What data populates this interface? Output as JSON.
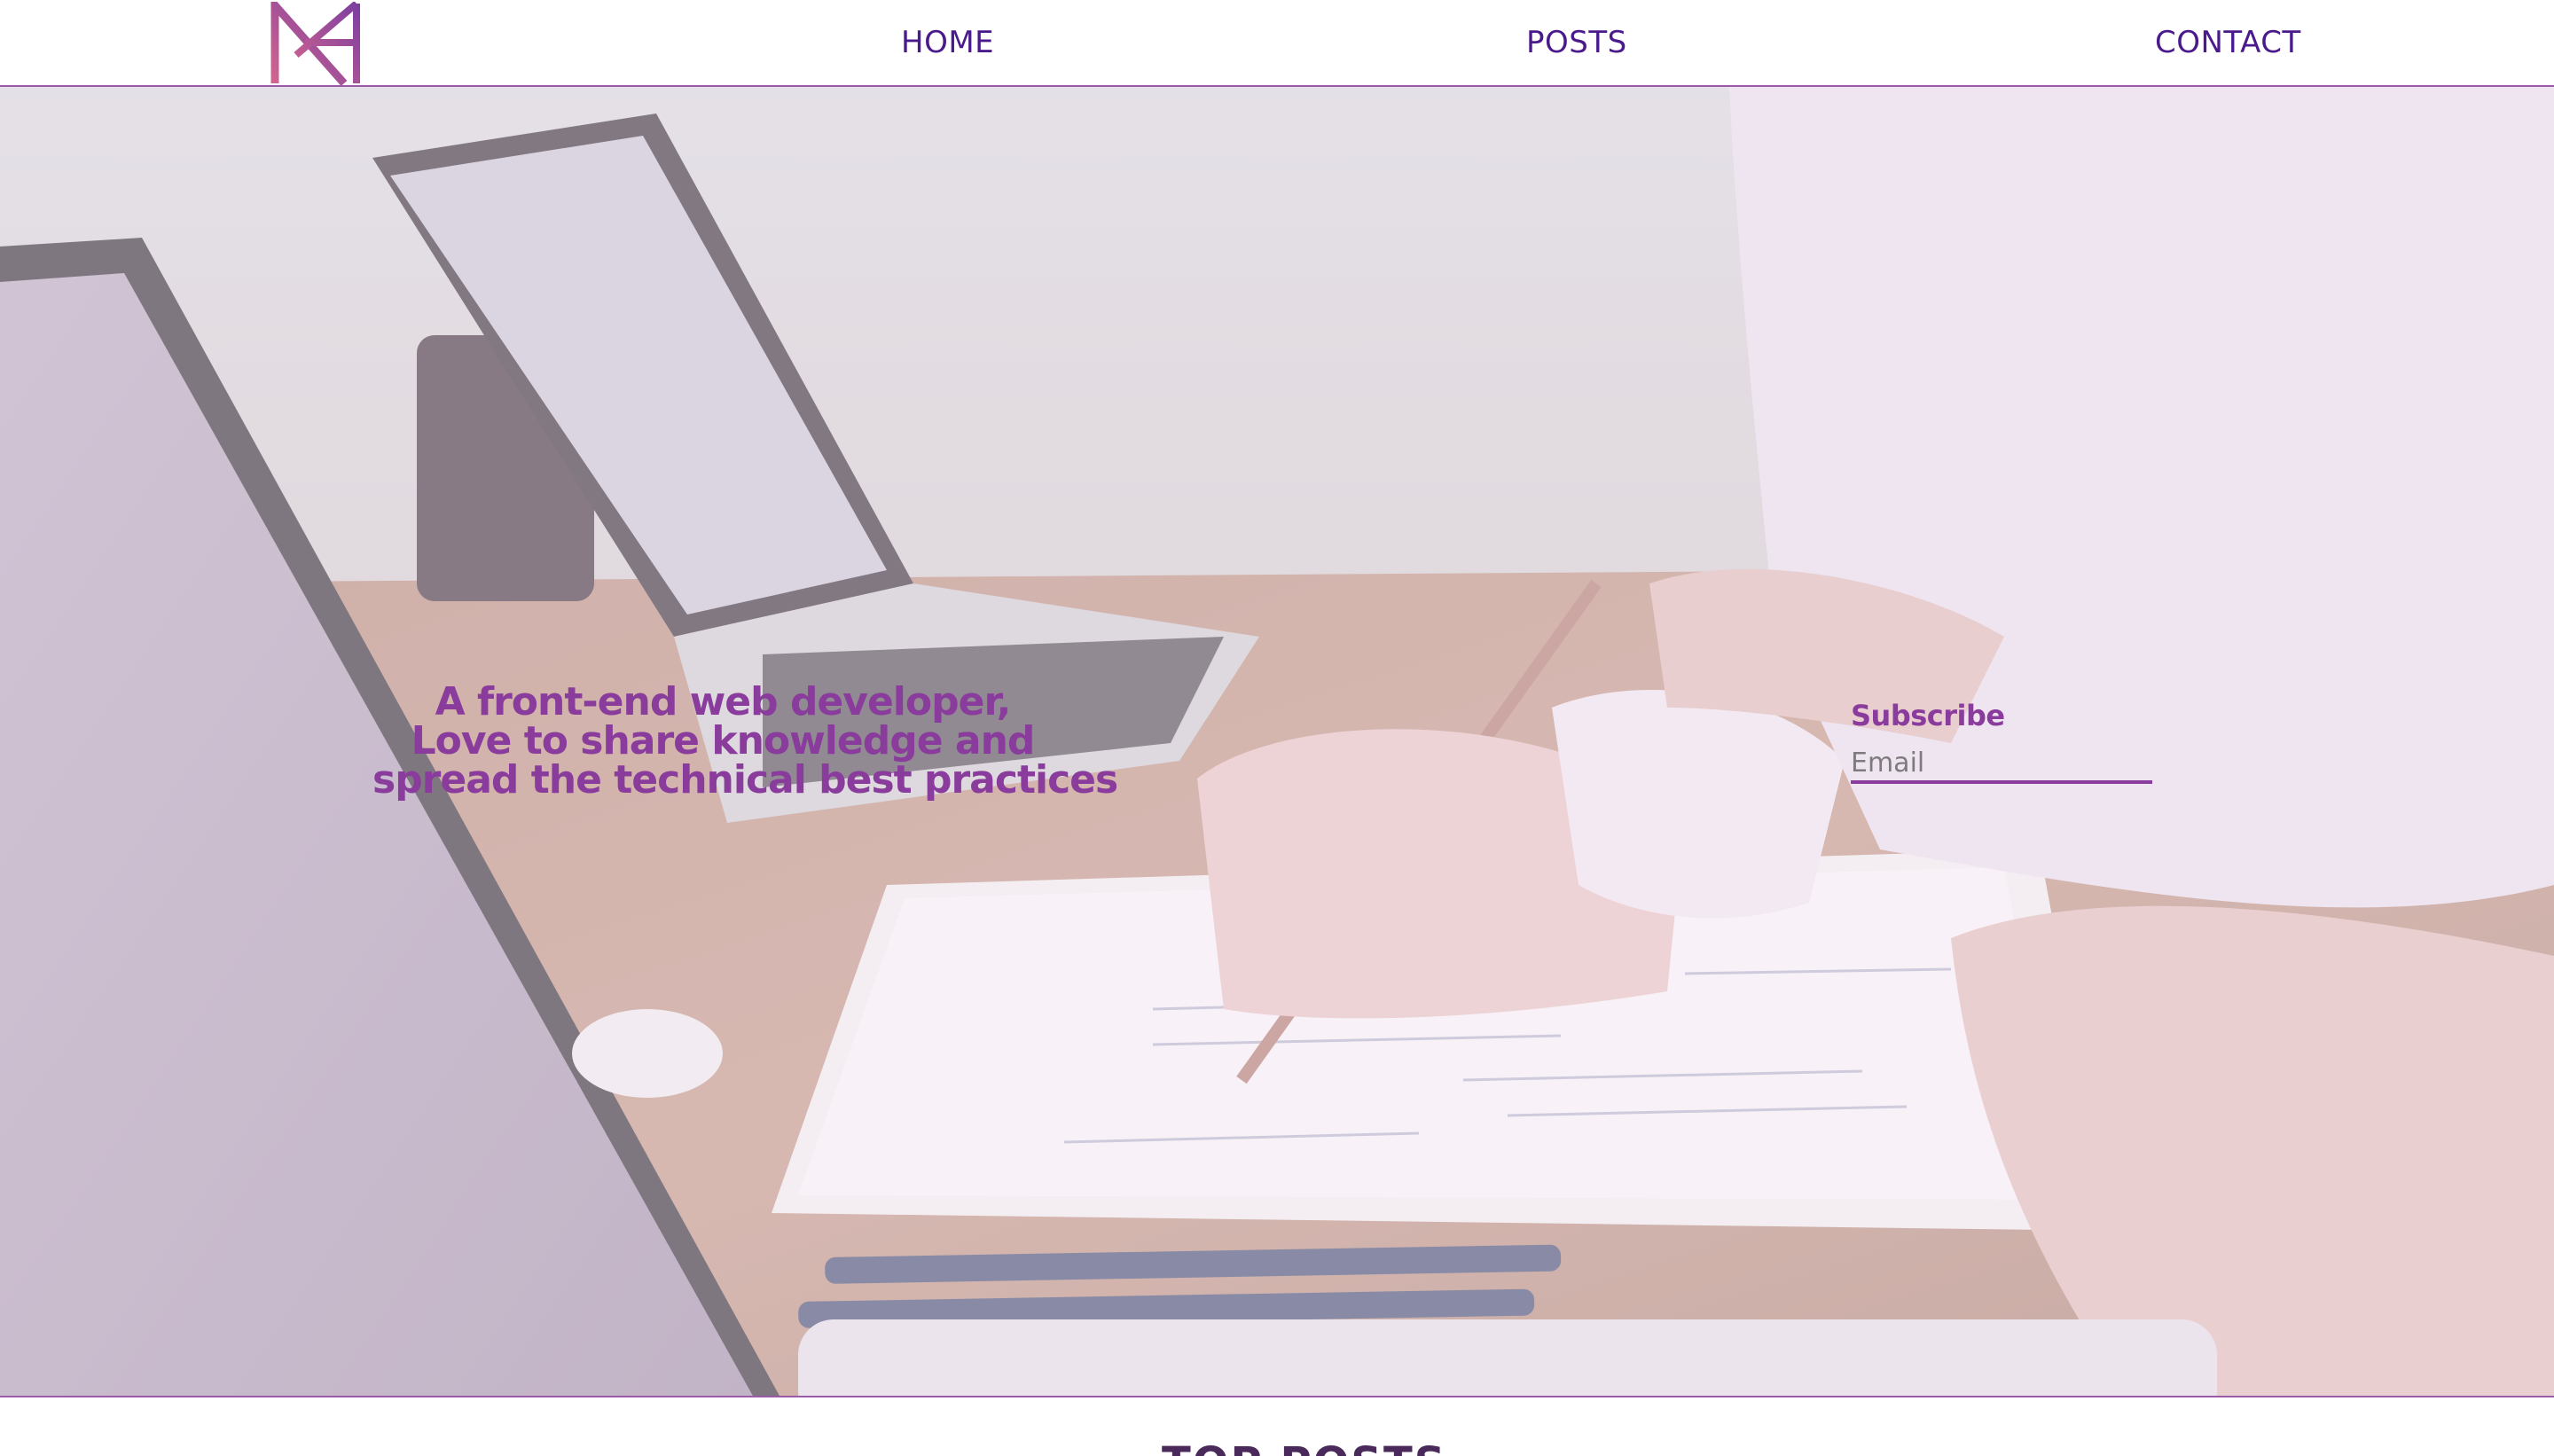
{
  "header": {
    "logo_name": "nh-monogram-logo",
    "nav": {
      "home": "HOME",
      "posts": "POSTS",
      "contact": "CONTACT"
    }
  },
  "hero": {
    "tagline": [
      "A front-end web developer,",
      "Love to share knowledge and",
      "spread the technical best practices"
    ],
    "subscribe": {
      "title": "Subscribe",
      "email_placeholder": "Email"
    }
  },
  "next_section": {
    "heading_partial": "TOP POSTS"
  },
  "colors": {
    "accent": "#8a3c9c",
    "nav_text": "#4a1a8c",
    "border": "#9b5aa8",
    "logo_pink": "#d0658f",
    "logo_purple": "#7d3fa0"
  }
}
